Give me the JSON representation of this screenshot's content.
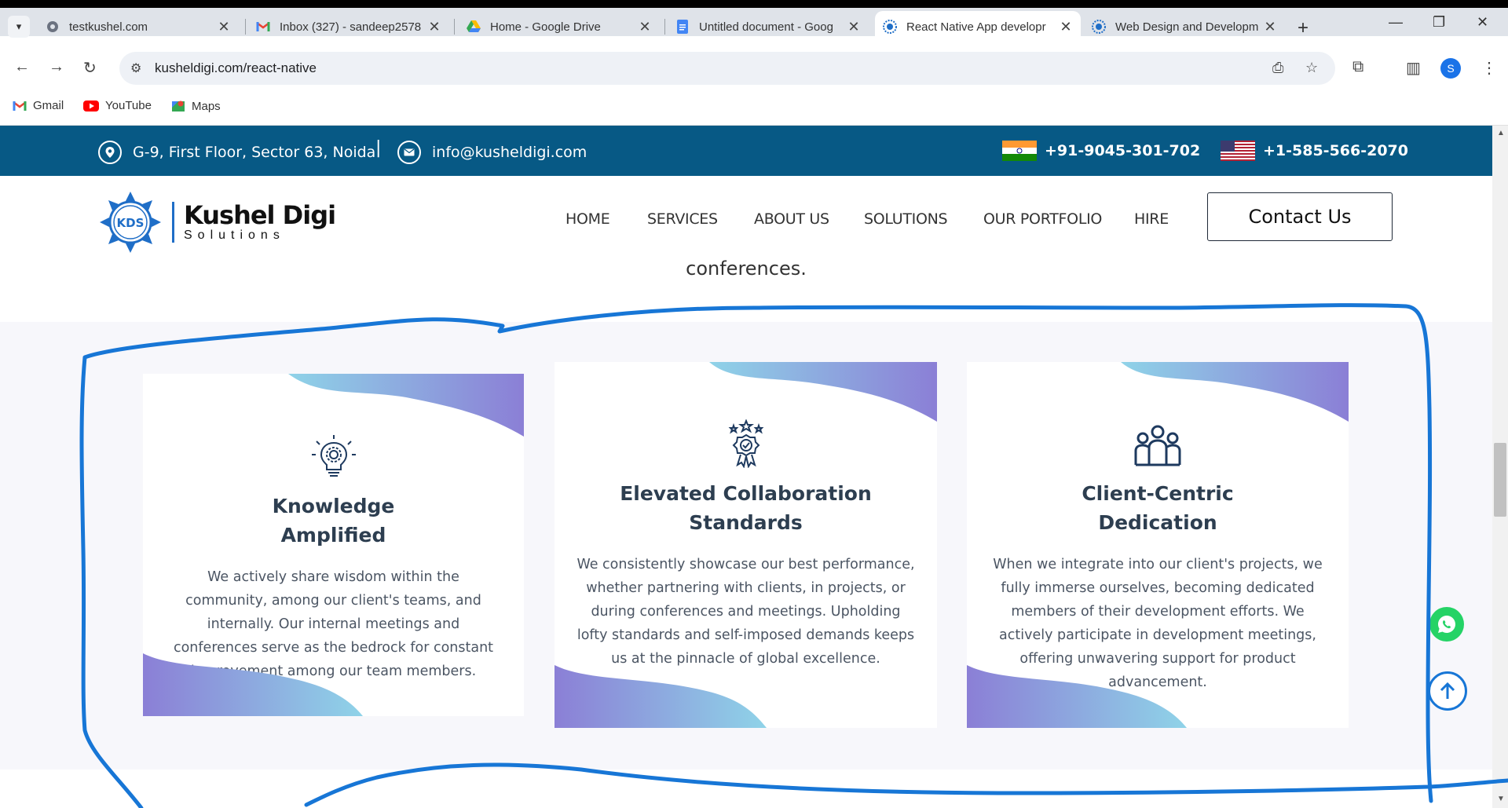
{
  "browser": {
    "tabs": [
      {
        "title": "testkushel.com",
        "icon": "globe-icon"
      },
      {
        "title": "Inbox (327) - sandeep2578",
        "icon": "gmail-icon"
      },
      {
        "title": "Home - Google Drive",
        "icon": "drive-icon"
      },
      {
        "title": "Untitled document - Goog",
        "icon": "docs-icon"
      },
      {
        "title": "React Native App developr",
        "icon": "kds-icon",
        "active": true
      },
      {
        "title": "Web Design and Developm",
        "icon": "kds-icon"
      }
    ],
    "url": "kusheldigi.com/react-native",
    "profile_initial": "S",
    "bookmarks": [
      {
        "label": "Gmail",
        "icon": "gmail-icon"
      },
      {
        "label": "YouTube",
        "icon": "youtube-icon"
      },
      {
        "label": "Maps",
        "icon": "maps-icon"
      }
    ]
  },
  "site": {
    "topbar": {
      "address": "G-9, First Floor, Sector 63, Noida",
      "separator": "|",
      "email": "info@kusheldigi.com",
      "phone_india": "+91-9045-301-702",
      "phone_us": "+1-585-566-2070"
    },
    "logo": {
      "badge": "KDS",
      "name": "Kushel Digi",
      "tagline": "Solutions"
    },
    "nav": [
      "HOME",
      "SERVICES",
      "ABOUT US",
      "SOLUTIONS",
      "OUR PORTFOLIO",
      "HIRE"
    ],
    "contact_button": "Contact Us",
    "intro_tail": "conferences.",
    "cards": [
      {
        "icon": "lightbulb-gear-icon",
        "title_line1": "Knowledge",
        "title_line2": "Amplified",
        "text": "We actively share wisdom within the community, among our client's teams, and internally. Our internal meetings and conferences serve as the bedrock for constant improvement among our team members."
      },
      {
        "icon": "award-badge-icon",
        "title_line1": "Elevated Collaboration",
        "title_line2": "Standards",
        "text": "We consistently showcase our best performance, whether partnering with clients, in projects, or during conferences and meetings. Upholding lofty standards and self-imposed demands keeps us at the pinnacle of global excellence."
      },
      {
        "icon": "team-people-icon",
        "title_line1": "Client-Centric",
        "title_line2": "Dedication",
        "text": "When we integrate into our client's projects, we fully immerse ourselves, becoming dedicated members of their development efforts. We actively participate in development meetings, offering unwavering support for product advancement."
      }
    ],
    "colors": {
      "topbar": "#075985",
      "accent": "#1f6ec7",
      "annotation": "#1776d6",
      "whatsapp": "#25d366"
    }
  }
}
